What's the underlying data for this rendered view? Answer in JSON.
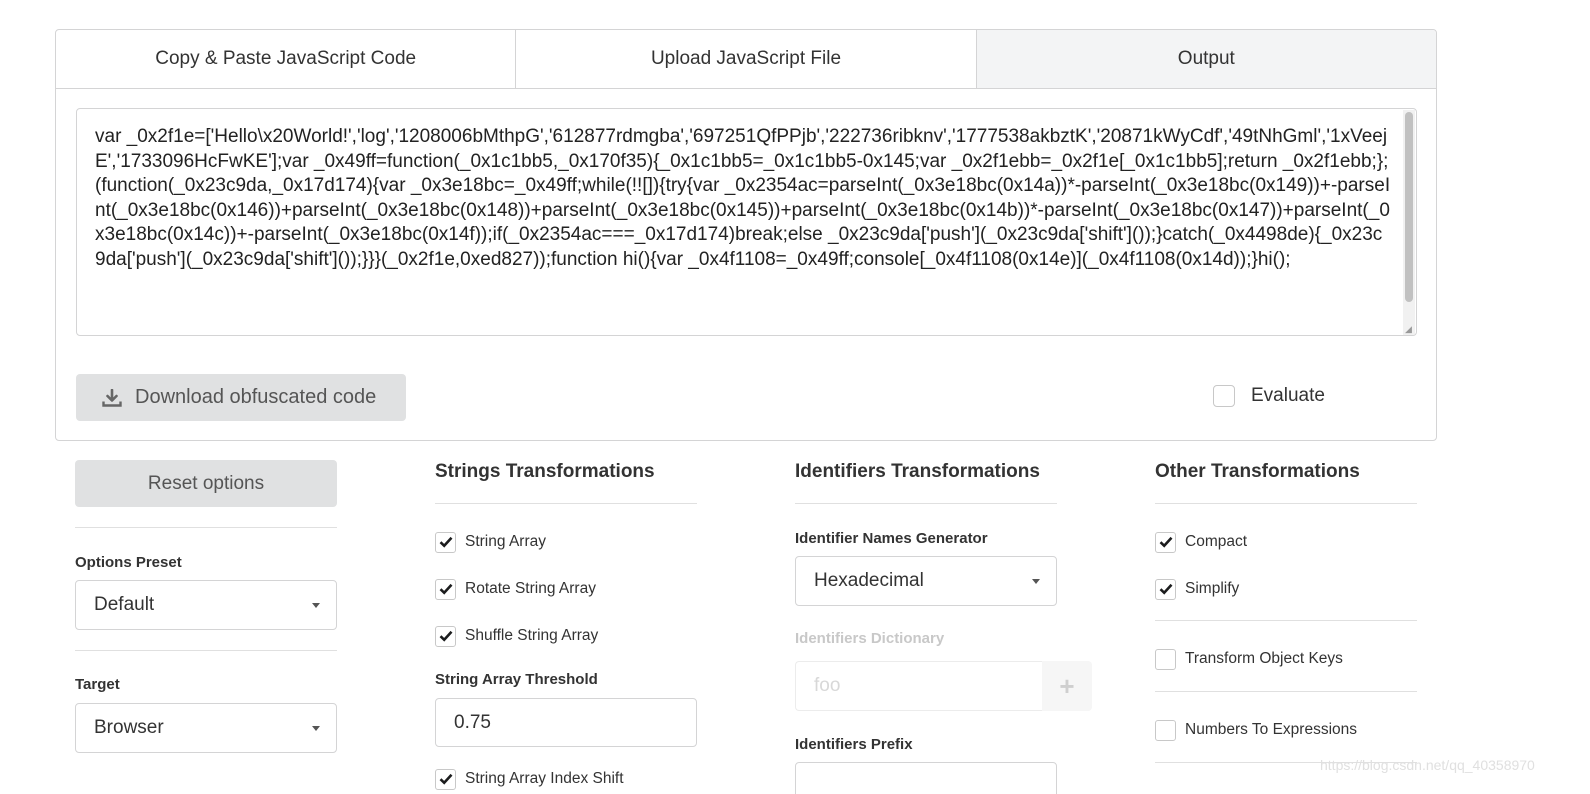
{
  "tabs": [
    {
      "label": "Copy & Paste JavaScript Code",
      "active": false
    },
    {
      "label": "Upload JavaScript File",
      "active": false
    },
    {
      "label": "Output",
      "active": true
    }
  ],
  "output": {
    "code": "var _0x2f1e=['Hello\\x20World!','log','1208006bMthpG','612877rdmgba','697251QfPPjb','222736ribknv','1777538akbztK','20871kWyCdf','49tNhGml','1xVeejE','1733096HcFwKE'];var _0x49ff=function(_0x1c1bb5,_0x170f35){_0x1c1bb5=_0x1c1bb5-0x145;var _0x2f1ebb=_0x2f1e[_0x1c1bb5];return _0x2f1ebb;};(function(_0x23c9da,_0x17d174){var _0x3e18bc=_0x49ff;while(!![]){try{var _0x2354ac=parseInt(_0x3e18bc(0x14a))*-parseInt(_0x3e18bc(0x149))+-parseInt(_0x3e18bc(0x146))+parseInt(_0x3e18bc(0x148))+parseInt(_0x3e18bc(0x145))+parseInt(_0x3e18bc(0x14b))*-parseInt(_0x3e18bc(0x147))+parseInt(_0x3e18bc(0x14c))+-parseInt(_0x3e18bc(0x14f));if(_0x2354ac===_0x17d174)break;else _0x23c9da['push'](_0x23c9da['shift']());}catch(_0x4498de){_0x23c9da['push'](_0x23c9da['shift']());}}}(_0x2f1e,0xed827));function hi(){var _0x4f1108=_0x49ff;console[_0x4f1108(0x14e)](_0x4f1108(0x14d));}hi();",
    "download_label": "Download obfuscated code",
    "evaluate_label": "Evaluate",
    "evaluate_checked": false
  },
  "options": {
    "reset_label": "Reset options",
    "preset_label": "Options Preset",
    "preset_value": "Default",
    "target_label": "Target",
    "target_value": "Browser"
  },
  "strings": {
    "title": "Strings Transformations",
    "items": [
      {
        "label": "String Array",
        "checked": true
      },
      {
        "label": "Rotate String Array",
        "checked": true
      },
      {
        "label": "Shuffle String Array",
        "checked": true
      }
    ],
    "threshold_label": "String Array Threshold",
    "threshold_value": "0.75",
    "partial_label": "String Array Index Shift",
    "partial_checked": true
  },
  "identifiers": {
    "title": "Identifiers Transformations",
    "generator_label": "Identifier Names Generator",
    "generator_value": "Hexadecimal",
    "dictionary_label": "Identifiers Dictionary",
    "dictionary_placeholder": "foo",
    "prefix_label": "Identifiers Prefix"
  },
  "other": {
    "title": "Other Transformations",
    "items": [
      {
        "label": "Compact",
        "checked": true
      },
      {
        "label": "Simplify",
        "checked": true
      },
      {
        "label": "Transform Object Keys",
        "checked": false
      },
      {
        "label": "Numbers To Expressions",
        "checked": false
      }
    ]
  },
  "watermark": "https://blog.csdn.net/qq_40358970",
  "colors": {
    "accent": "#e0e1e2",
    "border": "#d4d4d5",
    "check": "#1b1c1d"
  }
}
